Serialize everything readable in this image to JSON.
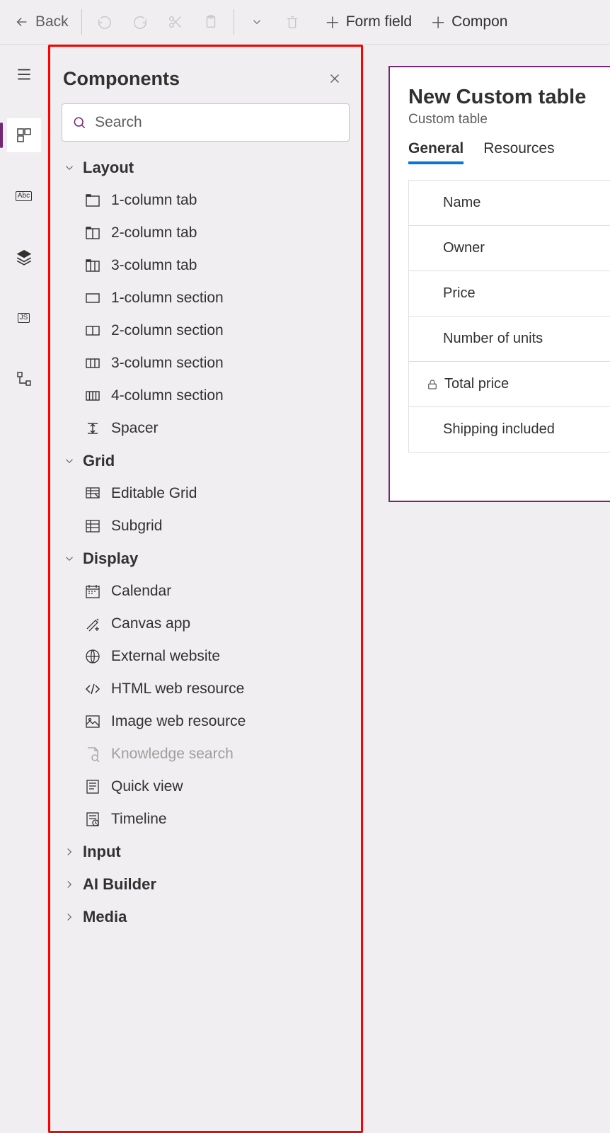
{
  "toolbar": {
    "back_label": "Back",
    "form_field_label": "Form field",
    "component_label": "Compon"
  },
  "panel": {
    "title": "Components",
    "search_placeholder": "Search",
    "groups": [
      {
        "name": "Layout",
        "expanded": true,
        "items": [
          {
            "label": "1-column tab",
            "icon": "one-col-tab"
          },
          {
            "label": "2-column tab",
            "icon": "two-col-tab"
          },
          {
            "label": "3-column tab",
            "icon": "three-col-tab"
          },
          {
            "label": "1-column section",
            "icon": "one-col-sec"
          },
          {
            "label": "2-column section",
            "icon": "two-col-sec"
          },
          {
            "label": "3-column section",
            "icon": "three-col-sec"
          },
          {
            "label": "4-column section",
            "icon": "four-col-sec"
          },
          {
            "label": "Spacer",
            "icon": "spacer"
          }
        ]
      },
      {
        "name": "Grid",
        "expanded": true,
        "items": [
          {
            "label": "Editable Grid",
            "icon": "edit-grid"
          },
          {
            "label": "Subgrid",
            "icon": "subgrid"
          }
        ]
      },
      {
        "name": "Display",
        "expanded": true,
        "items": [
          {
            "label": "Calendar",
            "icon": "calendar"
          },
          {
            "label": "Canvas app",
            "icon": "canvas"
          },
          {
            "label": "External website",
            "icon": "globe"
          },
          {
            "label": "HTML web resource",
            "icon": "code"
          },
          {
            "label": "Image web resource",
            "icon": "image"
          },
          {
            "label": "Knowledge search",
            "icon": "knowledge",
            "disabled": true
          },
          {
            "label": "Quick view",
            "icon": "quickview"
          },
          {
            "label": "Timeline",
            "icon": "timeline"
          }
        ]
      },
      {
        "name": "Input",
        "expanded": false
      },
      {
        "name": "AI Builder",
        "expanded": false
      },
      {
        "name": "Media",
        "expanded": false
      }
    ]
  },
  "form": {
    "title": "New Custom table",
    "subtitle": "Custom table",
    "tabs": [
      "General",
      "Resources"
    ],
    "active_tab": 0,
    "fields": [
      {
        "label": "Name"
      },
      {
        "label": "Owner"
      },
      {
        "label": "Price"
      },
      {
        "label": "Number of units"
      },
      {
        "label": "Total price",
        "locked": true
      },
      {
        "label": "Shipping included"
      }
    ]
  },
  "rail": {
    "abc": "Abc",
    "js": "JS"
  }
}
